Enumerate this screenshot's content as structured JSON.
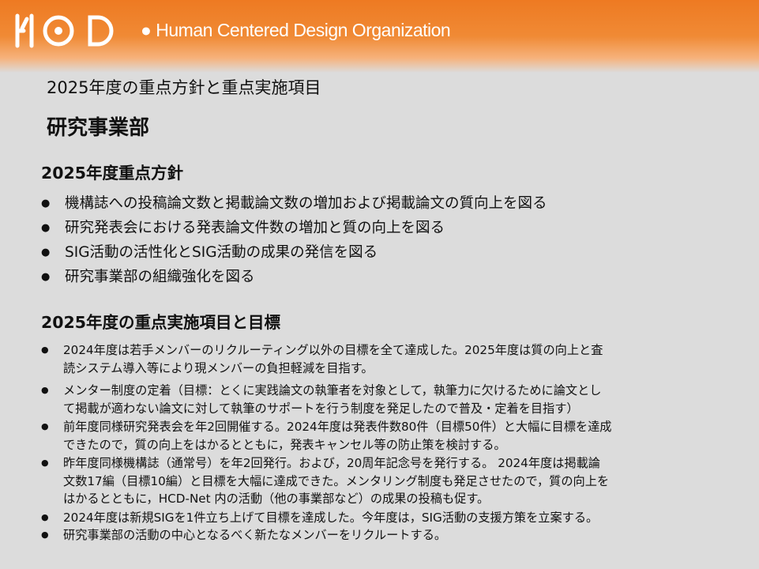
{
  "header": {
    "logo_mark": "HCD",
    "org_name": "● Human Centered Design Organization"
  },
  "page": {
    "subtitle": "2025年度の重点方針と重点実施項目",
    "department": "研究事業部"
  },
  "policies": {
    "heading": "2025年度重点方針",
    "items": [
      "機構誌への投稿論文数と掲載論文数の増加および掲載論文の質向上を図る",
      "研究発表会における発表論文件数の増加と質の向上を図る",
      "SIG活動の活性化とSIG活動の成果の発信を図る",
      "研究事業部の組織強化を図る"
    ]
  },
  "implementation": {
    "heading": "2025年度の重点実施項目と目標",
    "items": [
      {
        "lines": [
          "2024年度は若手メンバーのリクルーティング以外の目標を全て達成した。2025年度は質の向上と査",
          "読システム導入等により現メンバーの負担軽減を目指す。"
        ]
      },
      {
        "lines": [
          "メンター制度の定着（目標：とくに実践論文の執筆者を対象として，執筆力に欠けるために論文とし",
          "て掲載が適わない論文に対して執筆のサポートを行う制度を発足したので普及・定着を目指す）"
        ]
      },
      {
        "lines": [
          "前年度同様研究発表会を年2回開催する。2024年度は発表件数80件（目標50件）と大幅に目標を達成",
          "できたので，質の向上をはかるとともに，発表キャンセル等の防止策を検討する。"
        ]
      },
      {
        "lines": [
          "昨年度同様機構誌（通常号）を年2回発行。および，20周年記念号を発行する。 2024年度は掲載論",
          "文数17編（目標10編）と目標を大幅に達成できた。メンタリング制度も発足させたので，質の向上を",
          "はかるとともに，HCD-Net 内の活動（他の事業部など）の成果の投稿も促す。"
        ]
      },
      {
        "lines": [
          "2024年度は新規SIGを1件立ち上げて目標を達成した。今年度は，SIG活動の支援方策を立案する。"
        ]
      },
      {
        "lines": [
          "研究事業部の活動の中心となるべく新たなメンバーをリクルートする。"
        ]
      }
    ]
  }
}
